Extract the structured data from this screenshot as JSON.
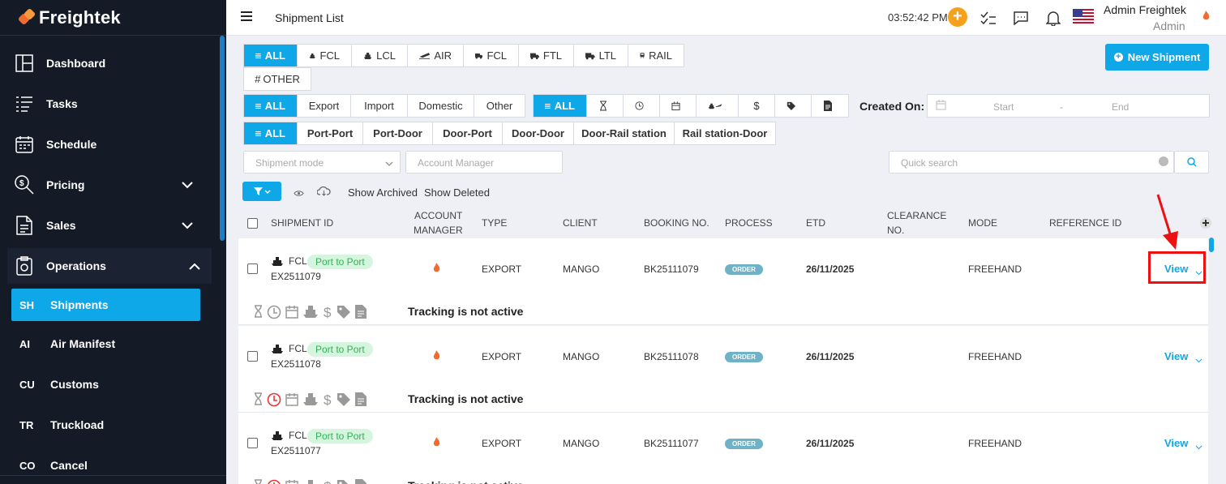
{
  "app": {
    "brand": "Freightek"
  },
  "sidebar": {
    "items": [
      {
        "label": "Dashboard"
      },
      {
        "label": "Tasks"
      },
      {
        "label": "Schedule"
      },
      {
        "label": "Pricing"
      },
      {
        "label": "Sales"
      },
      {
        "label": "Operations"
      }
    ],
    "sub_items": [
      {
        "abbr": "SH",
        "label": "Shipments"
      },
      {
        "abbr": "AI",
        "label": "Air Manifest"
      },
      {
        "abbr": "CU",
        "label": "Customs"
      },
      {
        "abbr": "TR",
        "label": "Truckload"
      },
      {
        "abbr": "CO",
        "label": "Cancel"
      }
    ]
  },
  "topbar": {
    "title": "Shipment List",
    "time": "03:52:42 PM",
    "user_name": "Admin Freightek",
    "user_role": "Admin"
  },
  "filters": {
    "mode_tabs": [
      "ALL",
      "FCL",
      "LCL",
      "AIR",
      "FCL",
      "FTL",
      "LTL",
      "RAIL"
    ],
    "other_tab": "OTHER",
    "direction_tabs": [
      "ALL",
      "Export",
      "Import",
      "Domestic",
      "Other"
    ],
    "status_all": "ALL",
    "created_on": "Created On:",
    "date_start": "Start",
    "date_sep": "-",
    "date_end": "End",
    "route_tabs": [
      "ALL",
      "Port-Port",
      "Port-Door",
      "Door-Port",
      "Door-Door",
      "Door-Rail station",
      "Rail station-Door"
    ],
    "shipment_mode_placeholder": "Shipment mode",
    "account_manager_placeholder": "Account Manager",
    "quick_search_placeholder": "Quick search",
    "show_archived": "Show Archived",
    "show_deleted": "Show Deleted"
  },
  "new_shipment": "New Shipment",
  "table": {
    "headers": {
      "shipment_id": "SHIPMENT ID",
      "account_manager_1": "ACCOUNT",
      "account_manager_2": "MANAGER",
      "type": "TYPE",
      "client": "CLIENT",
      "booking": "BOOKING NO.",
      "process": "PROCESS",
      "etd": "ETD",
      "clearance_1": "CLEARANCE",
      "clearance_2": "NO.",
      "mode": "MODE",
      "reference": "REFERENCE ID"
    },
    "rows": [
      {
        "mode_tag": "FCL",
        "route": "Port to Port",
        "id": "EX2511079",
        "type": "EXPORT",
        "client": "MANGO",
        "booking": "BK25111079",
        "process": "ORDER",
        "etd": "26/11/2025",
        "mode": "FREEHAND",
        "action": "View",
        "tracking": "Tracking is not active"
      },
      {
        "mode_tag": "FCL",
        "route": "Port to Port",
        "id": "EX2511078",
        "type": "EXPORT",
        "client": "MANGO",
        "booking": "BK25111078",
        "process": "ORDER",
        "etd": "26/11/2025",
        "mode": "FREEHAND",
        "action": "View",
        "tracking": "Tracking is not active"
      },
      {
        "mode_tag": "FCL",
        "route": "Port to Port",
        "id": "EX2511077",
        "type": "EXPORT",
        "client": "MANGO",
        "booking": "BK25111077",
        "process": "ORDER",
        "etd": "26/11/2025",
        "mode": "FREEHAND",
        "action": "View",
        "tracking": "Tracking is not active"
      }
    ]
  },
  "colors": {
    "accent": "#0ea7e8",
    "sidebar_bg": "#141b27",
    "orange": "#f7a01b",
    "annotation": "#ee1111"
  }
}
